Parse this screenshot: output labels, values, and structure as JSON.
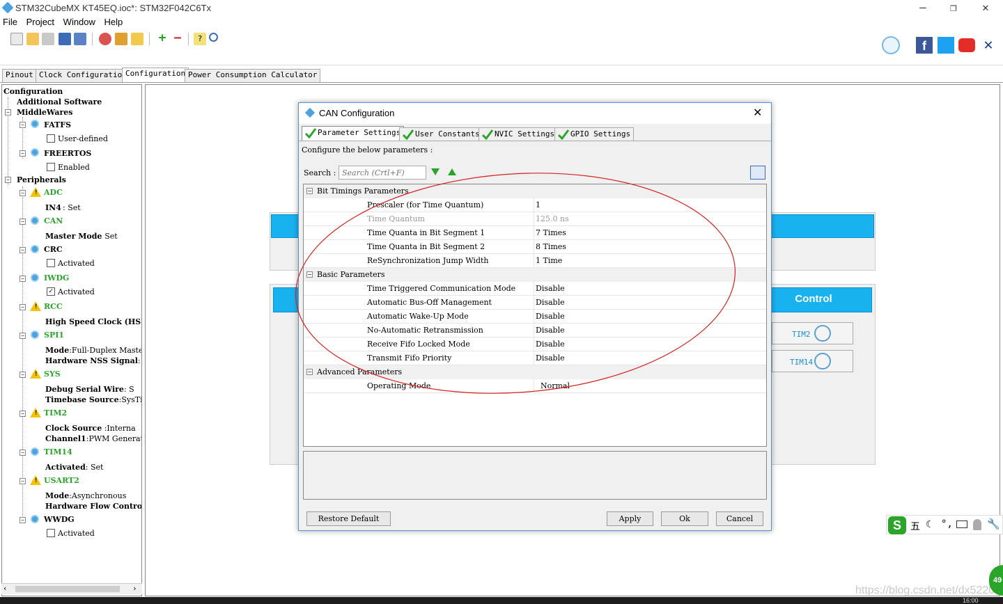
{
  "window": {
    "title": "STM32CubeMX KT45EQ.ioc*: STM32F042C6Tx",
    "minimize": "–",
    "maximize": "❐",
    "close": "✕"
  },
  "menu": [
    "File",
    "Project",
    "Window",
    "Help"
  ],
  "main_tabs": [
    "Pinout",
    "Clock Configuration",
    "Configuration",
    "Power Consumption Calculator"
  ],
  "tree": {
    "root": "Configuration",
    "additional": "Additional Software",
    "middlewares": "MiddleWares",
    "fatfs": "FATFS",
    "fatfs_opt": "User-defined",
    "freertos": "FREERTOS",
    "freertos_opt": "Enabled",
    "peripherals": "Peripherals",
    "adc": "ADC",
    "adc_in4": "IN4",
    "adc_in4_v": "Set",
    "can": "CAN",
    "can_mm": "Master Mode",
    "can_mm_v": "Set",
    "crc": "CRC",
    "crc_opt": "Activated",
    "iwdg": "IWDG",
    "iwdg_opt": "Activated",
    "rcc": "RCC",
    "rcc_hsc": "High Speed Clock (HS",
    "spi1": "SPI1",
    "spi1_mode": "Mode",
    "spi1_mode_v": "Full-Duplex Master",
    "spi1_nss": "Hardware NSS Signal",
    "sys": "SYS",
    "sys_dsw": "Debug Serial Wire",
    "sys_dsw_v": "S",
    "sys_tb": "Timebase Source",
    "sys_tb_v": "SysTi",
    "tim2": "TIM2",
    "tim2_cs": "Clock Source",
    "tim2_cs_v": "Interna",
    "tim2_ch": "Channel1",
    "tim2_ch_v": "PWM Generatio",
    "tim14": "TIM14",
    "tim14_act": "Activated",
    "tim14_act_v": "Set",
    "usart2": "USART2",
    "usart2_mode": "Mode",
    "usart2_mode_v": "Asynchronous",
    "usart2_hfc": "Hardware Flow Contro",
    "wwdg": "WWDG",
    "wwdg_opt": "Activated"
  },
  "background": {
    "control_title": "Control",
    "tim2": "TIM2",
    "tim14": "TIM14"
  },
  "dialog": {
    "title": "CAN Configuration",
    "tabs": [
      "Parameter Settings",
      "User Constants",
      "NVIC Settings",
      "GPIO Settings"
    ],
    "hint": "Configure the below parameters :",
    "search_label": "Search :",
    "search_placeholder": "Search (Crtl+F)",
    "groups": [
      {
        "name": "Bit Timings Parameters",
        "rows": [
          {
            "name": "Prescaler (for Time Quantum)",
            "value": "1",
            "disabled": false
          },
          {
            "name": "Time Quantum",
            "value": "125.0 ns",
            "disabled": true
          },
          {
            "name": "Time Quanta in Bit Segment 1",
            "value": "7 Times",
            "disabled": false
          },
          {
            "name": "Time Quanta in Bit Segment 2",
            "value": "8 Times",
            "disabled": false
          },
          {
            "name": "ReSynchronization Jump Width",
            "value": "1 Time",
            "disabled": false
          }
        ]
      },
      {
        "name": "Basic Parameters",
        "rows": [
          {
            "name": "Time Triggered Communication Mode",
            "value": "Disable",
            "disabled": false
          },
          {
            "name": "Automatic Bus-Off Management",
            "value": "Disable",
            "disabled": false
          },
          {
            "name": "Automatic Wake-Up Mode",
            "value": "Disable",
            "disabled": false
          },
          {
            "name": "No-Automatic Retransmission",
            "value": "Disable",
            "disabled": false
          },
          {
            "name": "Receive Fifo Locked Mode",
            "value": "Disable",
            "disabled": false
          },
          {
            "name": "Transmit Fifo Priority",
            "value": "Disable",
            "disabled": false
          }
        ]
      },
      {
        "name": "Advanced Parameters",
        "rows": [
          {
            "name": "Operating Mode",
            "value": "Normal",
            "disabled": false
          }
        ]
      }
    ],
    "buttons": {
      "restore": "Restore Default",
      "apply": "Apply",
      "ok": "Ok",
      "cancel": "Cancel"
    }
  },
  "ime": {
    "mode": "五"
  },
  "watermark": "https://blog.csdn.net/dx5220",
  "badge": "49",
  "clock": "16:00",
  "colors": {
    "accent": "#19b2f0",
    "green": "#2aa52a",
    "warn": "#f2c300"
  }
}
